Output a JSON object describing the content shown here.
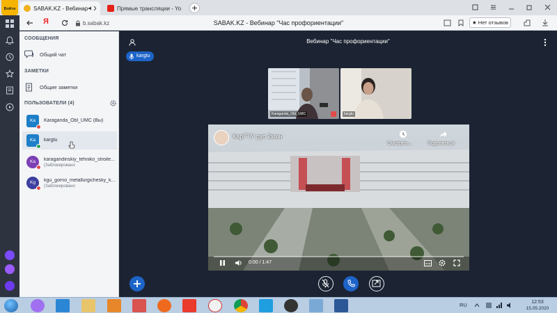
{
  "browser": {
    "yandex_button_label": "Войти",
    "tabs": [
      {
        "label": "SABAK.KZ - Вебинар",
        "active": true
      },
      {
        "label": "Прямые трансляции - Yo",
        "active": false
      }
    ],
    "address": "b.sabak.kz",
    "page_title": "SABAK.KZ - Вебинар \"Час профориентации\"",
    "reviews_label": "★ Нет отзывов"
  },
  "sidebar": {
    "messages_title": "СООБЩЕНИЯ",
    "public_chat": "Общий чат",
    "notes_title": "ЗАМЕТКИ",
    "shared_notes": "Общие заметки",
    "users_title": "ПОЛЬЗОВАТЕЛИ (4)",
    "users": [
      {
        "initials": "Ka",
        "name": "Karaganda_Obl_UMC (Вы)",
        "sub": ""
      },
      {
        "initials": "Ka",
        "name": "kargtu",
        "sub": ""
      },
      {
        "initials": "Ka",
        "name": "karagandinskiy_tehniko_stroite...",
        "sub": "(Заблокировано"
      },
      {
        "initials": "Kg",
        "name": "kgu_gorno_metallurgichesky_k...",
        "sub": "(Заблокировано"
      }
    ]
  },
  "meeting": {
    "title": "Вебинар \"Час профориентации\"",
    "presenter": "kargtu",
    "cams": [
      {
        "label": "Karaganda_Obl_UMC"
      },
      {
        "label": "kargtu"
      }
    ]
  },
  "video": {
    "title": "КарГТУ рус 2мин",
    "watch_later": "Смотреть...",
    "share": "Поделиться",
    "time": "0:00 / 1:47"
  },
  "taskbar": {
    "lang": "RU",
    "time": "12:53",
    "date": "15.05.2020"
  },
  "colors": {
    "accent": "#1d64c8",
    "meeting_bg": "#1c2433",
    "panel_bg": "#f4f5f7"
  }
}
